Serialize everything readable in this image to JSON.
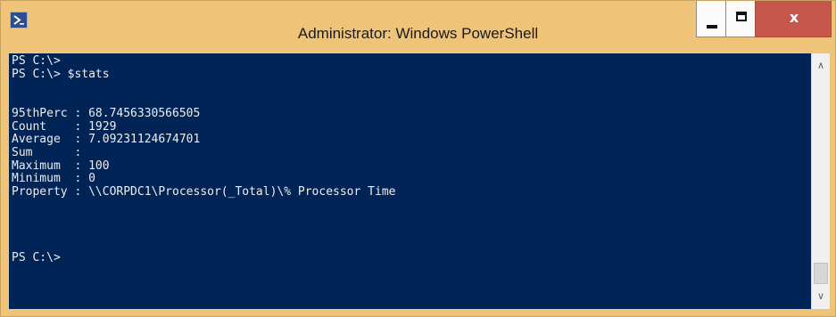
{
  "window": {
    "title": "Administrator: Windows PowerShell",
    "icon": "powershell-icon",
    "controls": {
      "minimize": "minimize-icon",
      "maximize": "maximize-icon",
      "close_label": "x"
    },
    "colors": {
      "frame": "#f0c478",
      "console_bg": "#012456",
      "console_fg": "#eeedf0",
      "close_bg": "#c7574d"
    }
  },
  "console": {
    "lines": [
      "PS C:\\>",
      "PS C:\\> $stats",
      "",
      "",
      "95thPerc : 68.7456330566505",
      "Count    : 1929",
      "Average  : 7.09231124674701",
      "Sum      :",
      "Maximum  : 100",
      "Minimum  : 0",
      "Property : \\\\CORPDC1\\Processor(_Total)\\% Processor Time",
      "",
      "",
      "",
      "",
      "PS C:\\>"
    ]
  },
  "scrollbar": {
    "up_icon": "scroll-up-arrow-icon",
    "down_icon": "scroll-down-arrow-icon"
  }
}
